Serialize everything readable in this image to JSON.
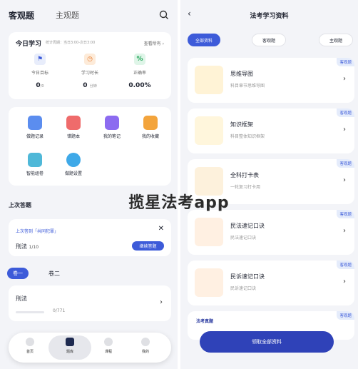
{
  "left": {
    "tabs": [
      "客观题",
      "主观题"
    ],
    "today": {
      "title": "今日学习",
      "subtitle": "统计周期：当日3:00-次日3:00",
      "more": "查看所有",
      "stats": [
        {
          "label": "今日目标",
          "value": "0",
          "unit": "/0"
        },
        {
          "label": "学习时长",
          "value": "0",
          "unit": "分钟"
        },
        {
          "label": "正确率",
          "value": "0.00%",
          "unit": ""
        }
      ]
    },
    "grid": [
      "做题记录",
      "错题本",
      "我的笔记",
      "我的收藏",
      "智能组卷",
      "做题设置"
    ],
    "last_section": "上次答题",
    "last": {
      "hint": "上次答到「共同犯罪」",
      "subject": "刑法",
      "progress": "1/10",
      "button": "继续答题"
    },
    "volume_tabs": [
      "卷一",
      "卷二"
    ],
    "subject_row": {
      "name": "刑法",
      "progress": "0/771",
      "fraction": 0
    },
    "bottom_nav": [
      "首页",
      "题库",
      "课程",
      "我的"
    ]
  },
  "right": {
    "title": "法考学习资料",
    "chips": [
      "全部资料",
      "客观题",
      "主观题"
    ],
    "materials": [
      {
        "name": "思维导图",
        "desc": "科目章节思维导图",
        "tag": "客观题"
      },
      {
        "name": "知识框架",
        "desc": "科目整体知识框架",
        "tag": "客观题"
      },
      {
        "name": "全科打卡表",
        "desc": "一轮复习打卡用",
        "tag": "客观题"
      },
      {
        "name": "民法速记口诀",
        "desc": "民法速记口诀",
        "tag": "客观题"
      },
      {
        "name": "民诉速记口诀",
        "desc": "民诉速记口诀",
        "tag": "客观题"
      },
      {
        "name": "",
        "desc": "",
        "tag": "客观题"
      }
    ],
    "thumb_caption": "法考真题",
    "get_button": "领取全部资料"
  },
  "watermark": "揽星法考app",
  "colors": {
    "accent": "#3d5bd9",
    "tag_bg": "#e5ecfb"
  }
}
